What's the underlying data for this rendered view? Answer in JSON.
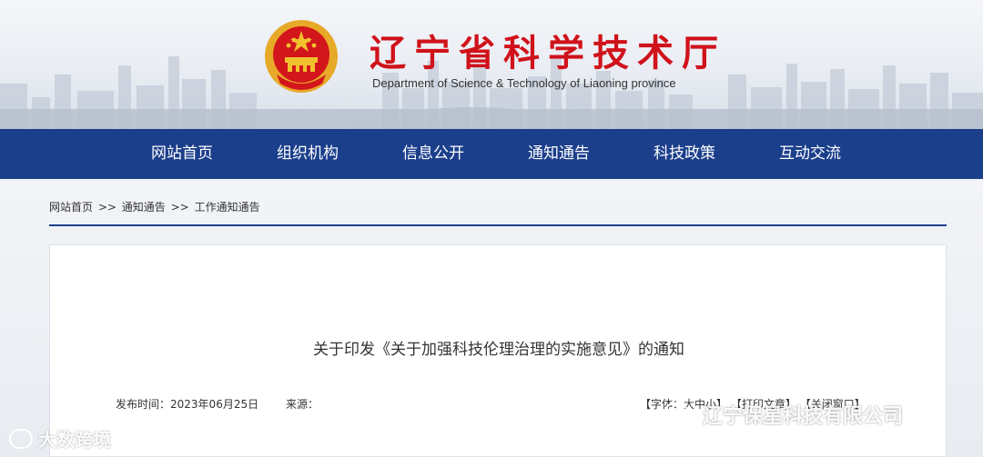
{
  "header": {
    "title": "辽宁省科学技术厅",
    "subtitle": "Department of Science & Technology of Liaoning province"
  },
  "nav": {
    "items": [
      "网站首页",
      "组织机构",
      "信息公开",
      "通知通告",
      "科技政策",
      "互动交流"
    ]
  },
  "breadcrumb": {
    "home": "网站首页",
    "sep1": ">>",
    "level2": "通知通告",
    "sep2": ">>",
    "level3": "工作通知通告"
  },
  "article": {
    "title": "关于印发《关于加强科技伦理治理的实施意见》的通知",
    "publish_label": "发布时间：",
    "publish_date": "2023年06月25日",
    "source_label": "来源："
  },
  "tools": {
    "font_size": "【字体：大中小】",
    "print": "【打印文章】",
    "close": "【关闭窗口】"
  },
  "watermarks": {
    "left": "大数跨境",
    "right": "辽宁保星科技有限公司"
  },
  "colors": {
    "brand_red": "#d0121b",
    "nav_blue": "#1c3f8c"
  },
  "icons": [
    "national-emblem-icon",
    "weibo-icon",
    "wechat-icon"
  ]
}
